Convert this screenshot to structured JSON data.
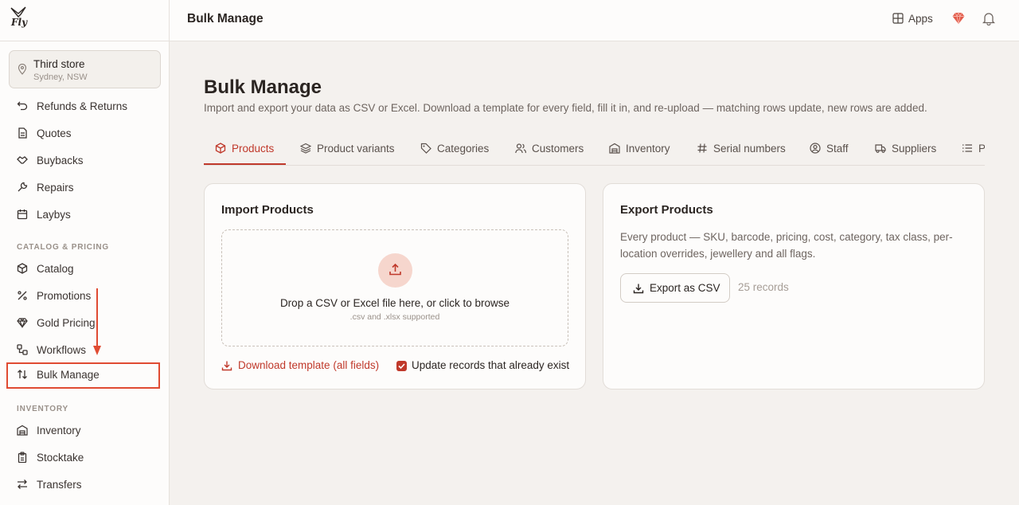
{
  "brand": {
    "logo_text": "Fly"
  },
  "store": {
    "name": "Third store",
    "location": "Sydney, NSW"
  },
  "sidebar": {
    "items_top": [
      {
        "label": "Refunds & Returns",
        "icon": "return-icon"
      },
      {
        "label": "Quotes",
        "icon": "document-icon"
      },
      {
        "label": "Buybacks",
        "icon": "handshake-icon"
      },
      {
        "label": "Repairs",
        "icon": "wrench-icon"
      },
      {
        "label": "Laybys",
        "icon": "calendar-icon"
      }
    ],
    "section_catalog": "CATALOG & PRICING",
    "items_catalog": [
      {
        "label": "Catalog",
        "icon": "box-icon"
      },
      {
        "label": "Promotions",
        "icon": "percent-icon"
      },
      {
        "label": "Gold Pricing",
        "icon": "gem-icon"
      },
      {
        "label": "Workflows",
        "icon": "workflow-icon"
      },
      {
        "label": "Bulk Manage",
        "icon": "arrows-up-down-icon"
      }
    ],
    "section_inventory": "INVENTORY",
    "items_inventory": [
      {
        "label": "Inventory",
        "icon": "warehouse-icon"
      },
      {
        "label": "Stocktake",
        "icon": "clipboard-icon"
      },
      {
        "label": "Transfers",
        "icon": "transfer-icon"
      }
    ]
  },
  "header": {
    "title": "Bulk Manage",
    "apps_label": "Apps"
  },
  "main": {
    "title": "Bulk Manage",
    "subtitle": "Import and export your data as CSV or Excel. Download a template for every field, fill it in, and re-upload — matching rows update, new rows are added.",
    "tabs": [
      {
        "label": "Products"
      },
      {
        "label": "Product variants"
      },
      {
        "label": "Categories"
      },
      {
        "label": "Customers"
      },
      {
        "label": "Inventory"
      },
      {
        "label": "Serial numbers"
      },
      {
        "label": "Staff"
      },
      {
        "label": "Suppliers"
      },
      {
        "label": "P"
      }
    ]
  },
  "import": {
    "title": "Import Products",
    "drop_text": "Drop a CSV or Excel file here, or click to browse",
    "drop_hint": ".csv and .xlsx supported",
    "download_label": "Download template (all fields)",
    "update_label": "Update records that already exist",
    "update_checked": true
  },
  "export": {
    "title": "Export Products",
    "description": "Every product — SKU, barcode, pricing, cost, category, tax class, per-location overrides, jewellery and all flags.",
    "button_label": "Export as CSV",
    "records": "25 records"
  },
  "colors": {
    "accent": "#c0392b",
    "highlight": "#e04b32"
  }
}
